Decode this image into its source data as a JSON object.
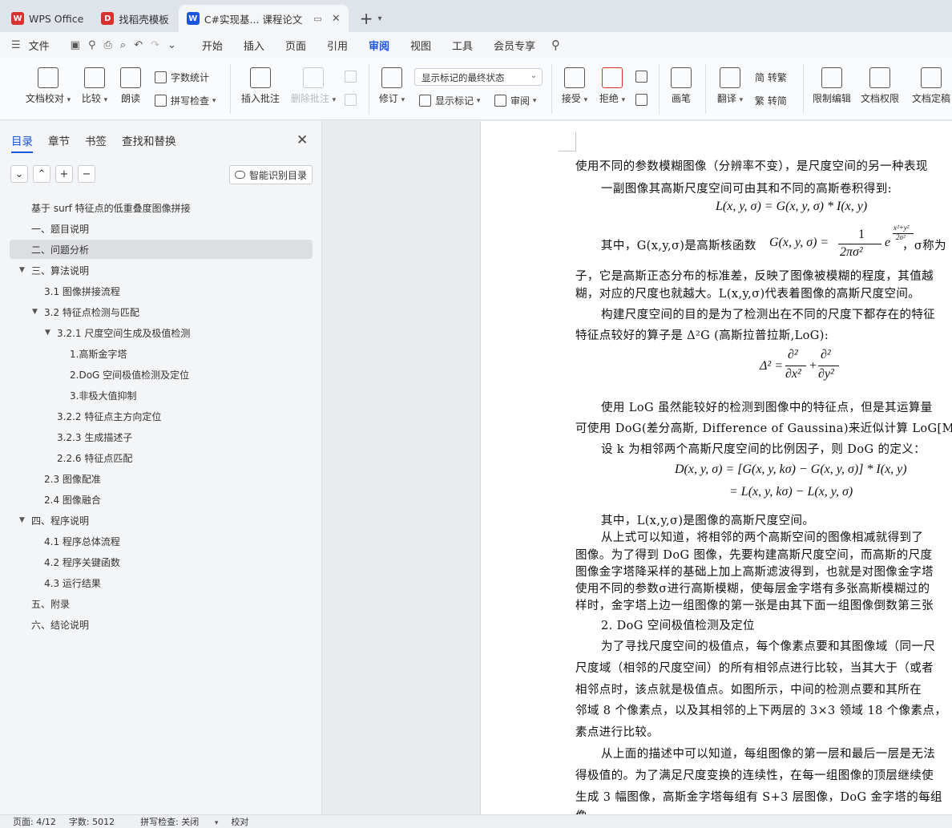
{
  "tabs": [
    {
      "label": "WPS Office",
      "icon": "wps-logo-icon",
      "color": "#d8322f"
    },
    {
      "label": "找稻壳模板",
      "icon": "docer-icon",
      "color": "#d8322f"
    },
    {
      "label": "C#实现基... 课程论文",
      "icon": "word-doc-icon",
      "color": "#1a56db"
    }
  ],
  "menu": {
    "file": "文件",
    "items": [
      "开始",
      "插入",
      "页面",
      "引用",
      "审阅",
      "视图",
      "工具",
      "会员专享"
    ],
    "active": "审阅"
  },
  "ribbon": {
    "doc_check": "文档校对",
    "compare": "比较",
    "read_aloud": "朗读",
    "word_count": "字数统计",
    "spell_check": "拼写检查",
    "insert_comment": "插入批注",
    "delete_comment": "删除批注",
    "revise": "修订",
    "markup_state": "显示标记的最终状态",
    "show_markup": "显示标记",
    "review_pane": "审阅",
    "accept": "接受",
    "reject": "拒绝",
    "pen": "画笔",
    "translate": "翻译",
    "simp_to_trad": "简 转繁",
    "trad_to_simp": "繁 转简",
    "restrict_edit": "限制编辑",
    "doc_permission": "文档权限",
    "doc_finalize": "文档定稿"
  },
  "sidebar": {
    "tabs": [
      "目录",
      "章节",
      "书签",
      "查找和替换"
    ],
    "smart_toc": "智能识别目录",
    "toc": [
      {
        "label": "基于 surf 特征点的低重叠度图像拼接"
      },
      {
        "label": "一、题目说明"
      },
      {
        "label": "二、问题分析"
      },
      {
        "label": "三、算法说明"
      },
      {
        "label": "3.1  图像拼接流程"
      },
      {
        "label": "3.2  特征点检测与匹配"
      },
      {
        "label": "3.2.1  尺度空间生成及极值检测"
      },
      {
        "label": "1.高斯金字塔"
      },
      {
        "label": "2.DoG 空间极值检测及定位"
      },
      {
        "label": "3.非极大值抑制"
      },
      {
        "label": "3.2.2  特征点主方向定位"
      },
      {
        "label": "3.2.3  生成描述子"
      },
      {
        "label": "2.2.6  特征点匹配"
      },
      {
        "label": "2.3  图像配准"
      },
      {
        "label": "2.4  图像融合"
      },
      {
        "label": "四、程序说明"
      },
      {
        "label": "4.1  程序总体流程"
      },
      {
        "label": "4.2 程序关键函数"
      },
      {
        "label": "4.3  运行结果"
      },
      {
        "label": "五、附录"
      },
      {
        "label": "六、结论说明"
      }
    ]
  },
  "doc": {
    "lines": [
      "使用不同的参数模糊图像（分辨率不变），是尺度空间的另一种表现",
      "一副图像其高斯尺度空间可由其和不同的高斯卷积得到:",
      "其中，G(x,y,σ)是高斯核函数",
      "，σ称为",
      "子，它是高斯正态分布的标准差，反映了图像被模糊的程度，其值越",
      "糊，对应的尺度也就越大。L(x,y,σ)代表着图像的高斯尺度空间。",
      "构建尺度空间的目的是为了检测出在不同的尺度下都存在的特征",
      "特征点较好的算子是 Δ²G (高斯拉普拉斯,LoG):",
      "使用 LoG 虽然能较好的检测到图像中的特征点，但是其运算量",
      "可使用 DoG(差分高斯, Difference of Gaussina)来近似计算 LoG[Marr",
      "设 k 为相邻两个高斯尺度空间的比例因子，则 DoG 的定义：",
      "其中，L(x,y,σ)是图像的高斯尺度空间。",
      "从上式可以知道，将相邻的两个高斯空间的图像相减就得到了",
      "图像。为了得到 DoG 图像，先要构建高斯尺度空间，而高斯的尺度",
      "图像金字塔降采样的基础上加上高斯滤波得到，也就是对图像金字塔",
      "使用不同的参数σ进行高斯模糊，使每层金字塔有多张高斯模糊过的",
      "样时，金字塔上边一组图像的第一张是由其下面一组图像倒数第三张",
      "2.   DoG 空间极值检测及定位",
      "为了寻找尺度空间的极值点，每个像素点要和其图像域（同一尺",
      "尺度域（相邻的尺度空间）的所有相邻点进行比较，当其大于（或者",
      "相邻点时，该点就是极值点。如图所示，中间的检测点要和其所在",
      "邻域 8 个像素点，以及其相邻的上下两层的 3×3 领域 18 个像素点，",
      "素点进行比较。",
      "从上面的描述中可以知道，每组图像的第一层和最后一层是无法",
      "得极值的。为了满足尺度变换的连续性，在每一组图像的顶层继续使",
      "生成 3 幅图像，高斯金字塔每组有 S+3 层图像，DoG 金字塔的每组",
      "像。"
    ],
    "formulas": {
      "f1": "L(x, y, σ) = G(x, y, σ) * I(x, y)",
      "f2a": "G(x, y, σ) =",
      "f2_num": "1",
      "f2_den": "2πσ²",
      "f2_e": "e",
      "f2_exp_num": "x²+y²",
      "f2_exp_den": "2σ²",
      "f3a": "Δ² =",
      "f3_num1": "∂²",
      "f3_den1": "∂x²",
      "f3_plus": "+",
      "f3_num2": "∂²",
      "f3_den2": "∂y²",
      "f4": "D(x, y, σ) = [G(x, y, kσ) − G(x, y, σ)] * I(x, y)",
      "f5": "= L(x, y, kσ) − L(x, y, σ)"
    }
  },
  "status": {
    "page": "页面: 4/12",
    "words": "字数: 5012",
    "spell": "拼写检查: 关闭",
    "proof": "校对"
  }
}
